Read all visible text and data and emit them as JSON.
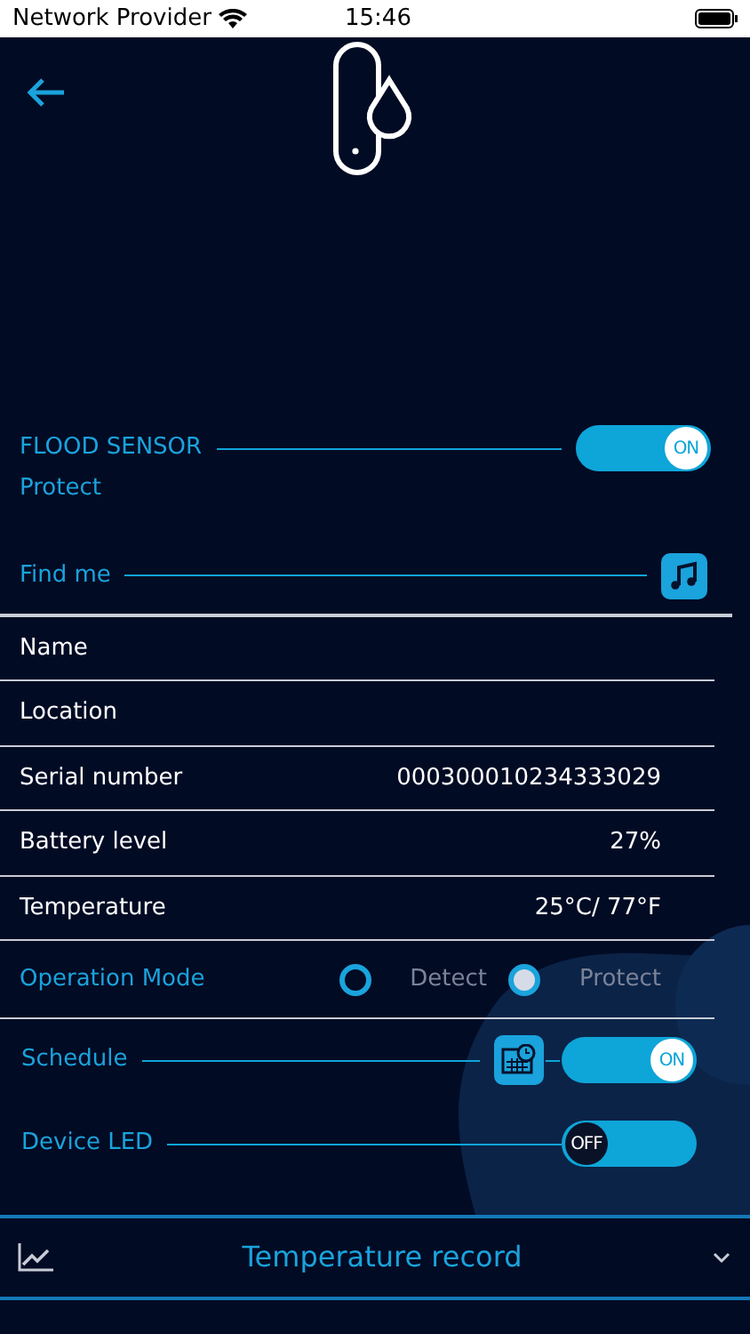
{
  "status_bar": {
    "carrier": "Network Provider",
    "time": "15:46"
  },
  "device": {
    "title": "FLOOD SENSOR",
    "mode": "Protect",
    "on": true,
    "switch_text": "ON"
  },
  "find_me": {
    "label": "Find me"
  },
  "info_rows": [
    {
      "label": "Name"
    },
    {
      "label": "Location"
    },
    {
      "label": "Serial number",
      "value": "000300010234333029"
    },
    {
      "label": "Battery level",
      "value": "27%"
    },
    {
      "label": "Temperature",
      "value": "25°C/ 77°F"
    }
  ],
  "operation_mode": {
    "label": "Operation Mode",
    "options": [
      {
        "label": "Detect",
        "selected": false
      },
      {
        "label": "Protect",
        "selected": true
      }
    ]
  },
  "schedule": {
    "label": "Schedule",
    "on": true,
    "switch_text": "ON"
  },
  "device_led": {
    "label": "Device LED",
    "on": false,
    "switch_text": "OFF"
  },
  "footer": {
    "label": "Temperature record"
  }
}
